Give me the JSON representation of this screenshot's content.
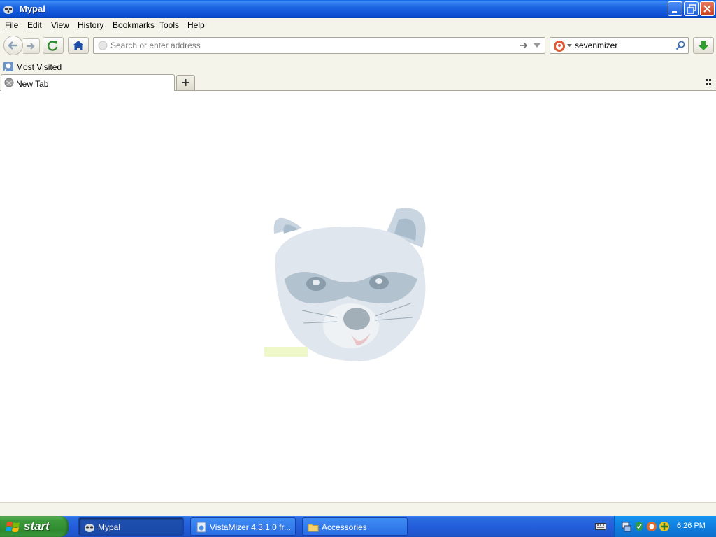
{
  "window": {
    "title": "Mypal"
  },
  "menu": {
    "items": [
      {
        "label": "File",
        "key": "F",
        "rest": "ile"
      },
      {
        "label": "Edit",
        "key": "E",
        "rest": "dit"
      },
      {
        "label": "View",
        "key": "V",
        "rest": "iew"
      },
      {
        "label": "History",
        "key": "H",
        "rest": "istory"
      },
      {
        "label": "Bookmarks",
        "key": "B",
        "rest": "ookmarks"
      },
      {
        "label": "Tools",
        "key": "T",
        "rest": "ools"
      },
      {
        "label": "Help",
        "key": "H",
        "rest": "elp"
      }
    ]
  },
  "navbar": {
    "url_placeholder": "Search or enter address",
    "url_value": "",
    "search_value": "sevenmizer"
  },
  "bookmarks": {
    "items": [
      {
        "label": "Most Visited"
      }
    ]
  },
  "tabs": [
    {
      "label": "New Tab",
      "active": true
    }
  ],
  "taskbar": {
    "start_label": "start",
    "tasks": [
      {
        "label": "Mypal",
        "active": true
      },
      {
        "label": "VistaMizer 4.3.1.0 fr...",
        "active": false
      },
      {
        "label": "Accessories",
        "active": false
      }
    ],
    "clock": "6:26 PM"
  },
  "colors": {
    "titlebar": "#0a4cd0",
    "taskbar": "#245edb",
    "start": "#3c9a3c",
    "tray": "#0f7fe0"
  }
}
